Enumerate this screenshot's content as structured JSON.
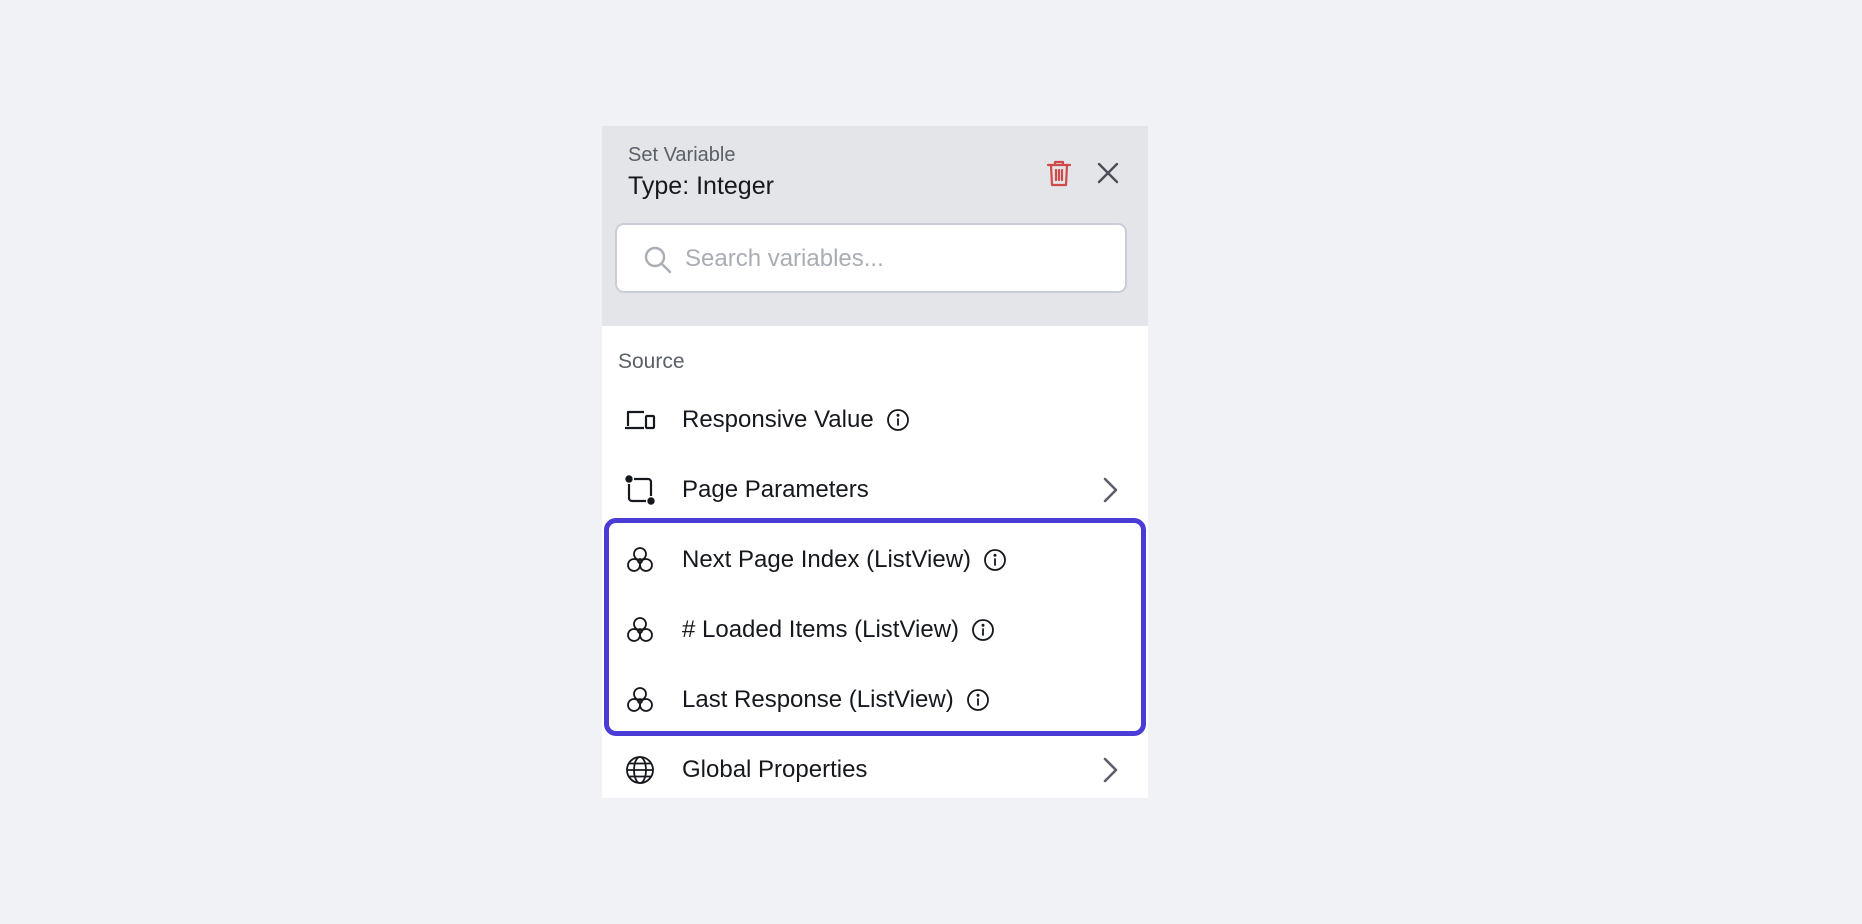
{
  "header": {
    "title": "Set Variable",
    "subtitle": "Type: Integer",
    "trash_color": "#d04a4a"
  },
  "search": {
    "placeholder": "Search variables..."
  },
  "source": {
    "label": "Source",
    "items": [
      {
        "label": "Responsive Value",
        "icon": "devices-icon",
        "has_info": true,
        "has_chevron": false
      },
      {
        "label": "Page Parameters",
        "icon": "page-parameters-icon",
        "has_info": false,
        "has_chevron": true
      },
      {
        "label": "Next Page Index (ListView)",
        "icon": "widget-icon",
        "has_info": true,
        "has_chevron": false
      },
      {
        "label": "# Loaded Items (ListView)",
        "icon": "widget-icon",
        "has_info": true,
        "has_chevron": false
      },
      {
        "label": "Last Response (ListView)",
        "icon": "widget-icon",
        "has_info": true,
        "has_chevron": false
      },
      {
        "label": "Global Properties",
        "icon": "globe-icon",
        "has_info": false,
        "has_chevron": true
      }
    ]
  },
  "colors": {
    "page_background": "#f1f2f5",
    "header_background": "#e3e5e9",
    "highlight_border": "#4b3bd7"
  }
}
